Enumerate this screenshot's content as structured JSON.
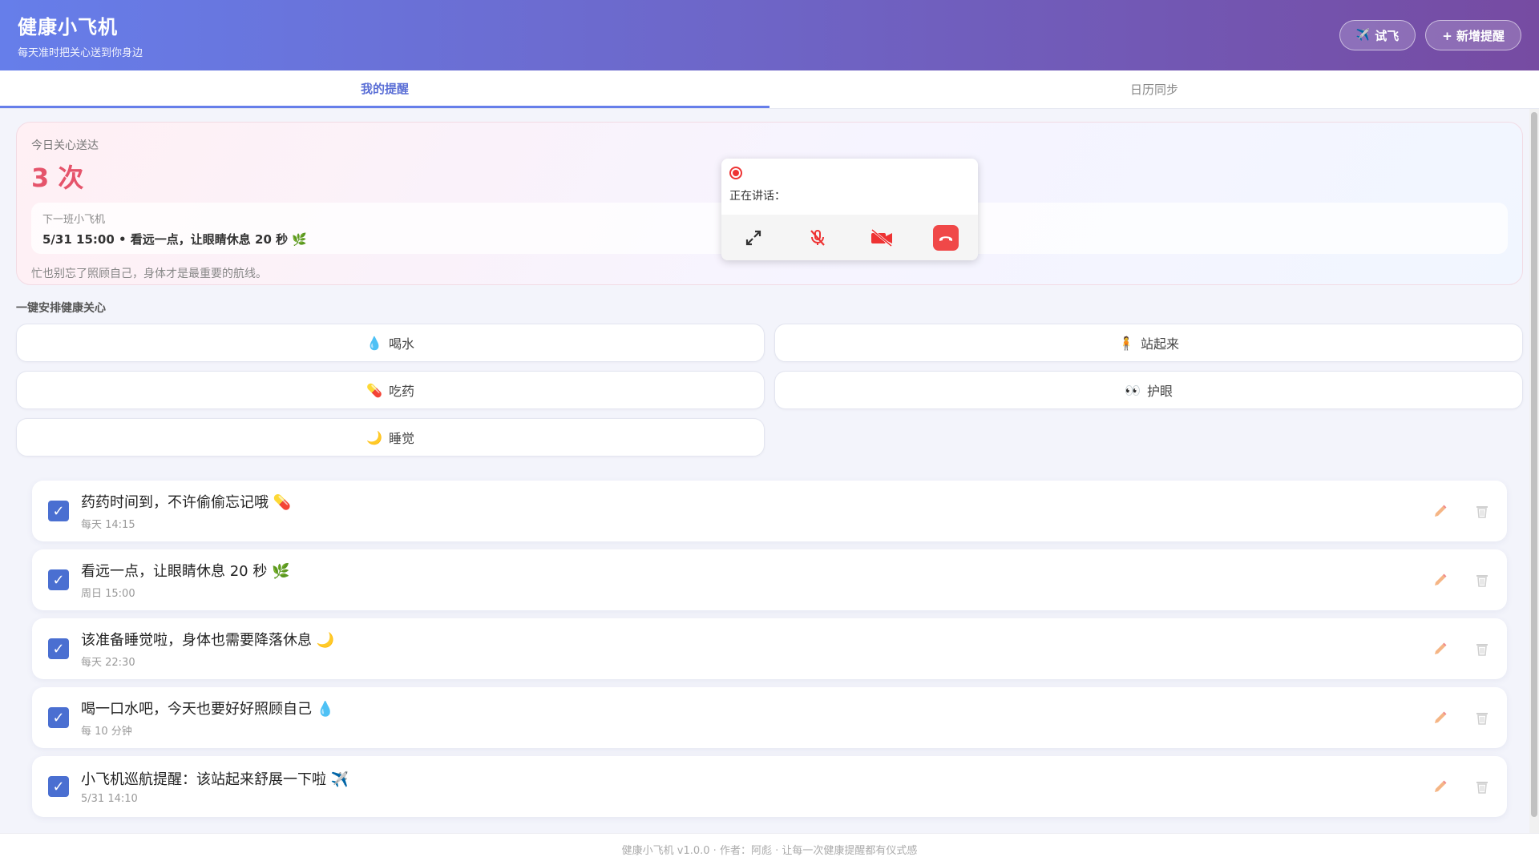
{
  "header": {
    "title": "健康小飞机",
    "subtitle": "每天准时把关心送到你身边",
    "test_fly_label": "试飞",
    "add_reminder_label": "+ 新增提醒"
  },
  "tabs": [
    {
      "label": "我的提醒",
      "active": true
    },
    {
      "label": "日历同步",
      "active": false
    }
  ],
  "summary": {
    "today_label": "今日关心送达",
    "today_count": "3 次",
    "next_label": "下一班小飞机",
    "next_value": "5/31 15:00 • 看远一点，让眼睛休息 20 秒 🌿",
    "note": "忙也别忘了照顾自己，身体才是最重要的航线。"
  },
  "quick": {
    "title": "一键安排健康关心",
    "items": [
      {
        "emoji": "💧",
        "label": "喝水"
      },
      {
        "emoji": "🧍",
        "label": "站起来"
      },
      {
        "emoji": "💊",
        "label": "吃药"
      },
      {
        "emoji": "👀",
        "label": "护眼"
      },
      {
        "emoji": "🌙",
        "label": "睡觉"
      }
    ]
  },
  "reminders": [
    {
      "title": "药药时间到，不许偷偷忘记哦 💊",
      "time": "每天 14:15",
      "checked": true
    },
    {
      "title": "看远一点，让眼睛休息 20 秒 🌿",
      "time": "周日 15:00",
      "checked": true
    },
    {
      "title": "该准备睡觉啦，身体也需要降落休息 🌙",
      "time": "每天 22:30",
      "checked": true
    },
    {
      "title": "喝一口水吧，今天也要好好照顾自己 💧",
      "time": "每 10 分钟",
      "checked": true
    },
    {
      "title": "小飞机巡航提醒：该站起来舒展一下啦 ✈️",
      "time": "5/31 14:10",
      "checked": true
    }
  ],
  "call": {
    "speaking_label": "正在讲话："
  },
  "footer": {
    "text": "健康小飞机 v1.0.0 · 作者：阿彪 · 让每一次健康提醒都有仪式感"
  },
  "colors": {
    "accent": "#667eea",
    "accent_end": "#764ba2",
    "count": "#e5546b",
    "hangup": "#f04848"
  }
}
